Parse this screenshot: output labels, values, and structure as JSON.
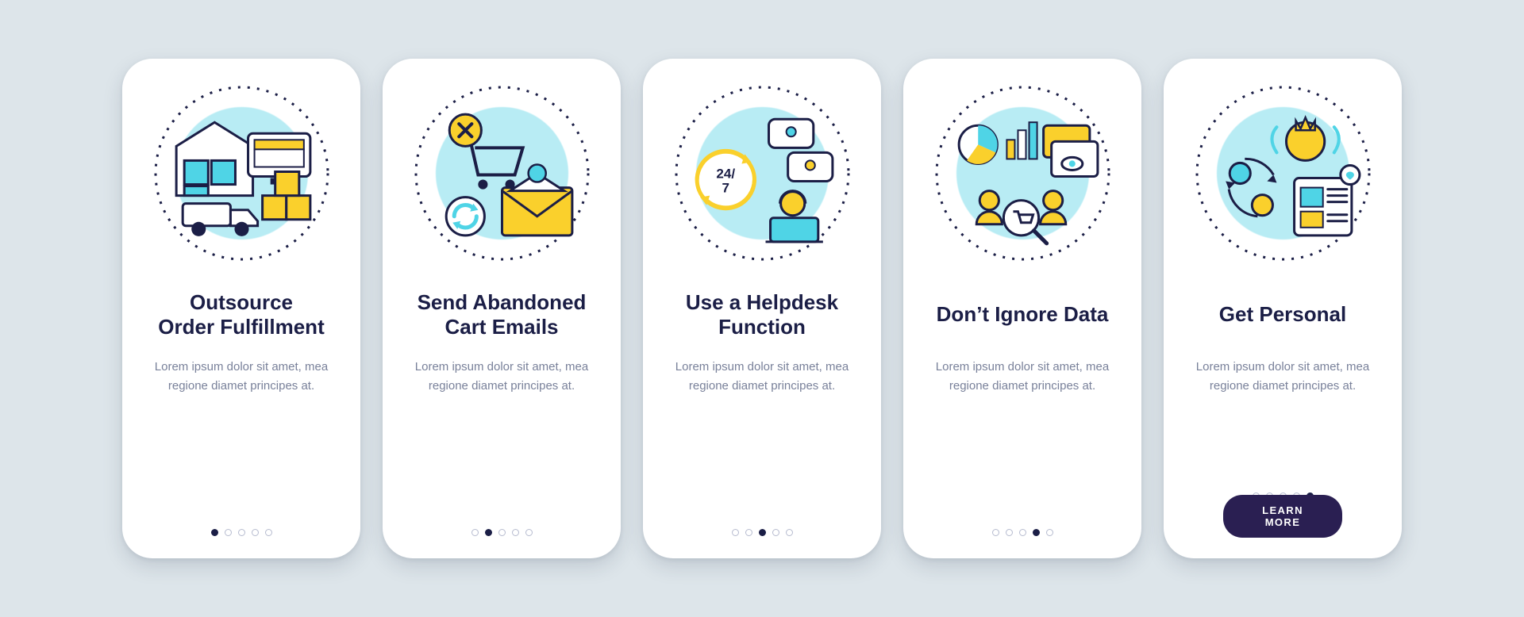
{
  "colors": {
    "bg": "#dde5ea",
    "card": "#ffffff",
    "ink": "#1b1e46",
    "muted": "#79819a",
    "accentCyan": "#b8ecf4",
    "accentYellow": "#fad02c",
    "accentBlue": "#4fd4e6",
    "ctaBg": "#2a1f52"
  },
  "slides": [
    {
      "id": "s1",
      "icon": "fulfillment-icon",
      "title": "Outsource\nOrder Fulfillment",
      "body": "Lorem ipsum dolor sit amet, mea regione diamet principes at.",
      "activeDot": 0,
      "hasCta": false
    },
    {
      "id": "s2",
      "icon": "abandoned-cart-icon",
      "title": "Send Abandoned\nCart Emails",
      "body": "Lorem ipsum dolor sit amet, mea regione diamet principes at.",
      "activeDot": 1,
      "hasCta": false
    },
    {
      "id": "s3",
      "icon": "helpdesk-icon",
      "title": "Use a Helpdesk\nFunction",
      "body": "Lorem ipsum dolor sit amet, mea regione diamet principes at.",
      "activeDot": 2,
      "hasCta": false
    },
    {
      "id": "s4",
      "icon": "data-icon",
      "title": "Don’t Ignore Data",
      "body": "Lorem ipsum dolor sit amet, mea regione diamet principes at.",
      "activeDot": 3,
      "hasCta": false
    },
    {
      "id": "s5",
      "icon": "personal-icon",
      "title": "Get Personal",
      "body": "Lorem ipsum dolor sit amet, mea regione diamet principes at.",
      "activeDot": 4,
      "hasCta": true
    }
  ],
  "cta": {
    "label": "LEARN MORE"
  },
  "dotCount": 5
}
